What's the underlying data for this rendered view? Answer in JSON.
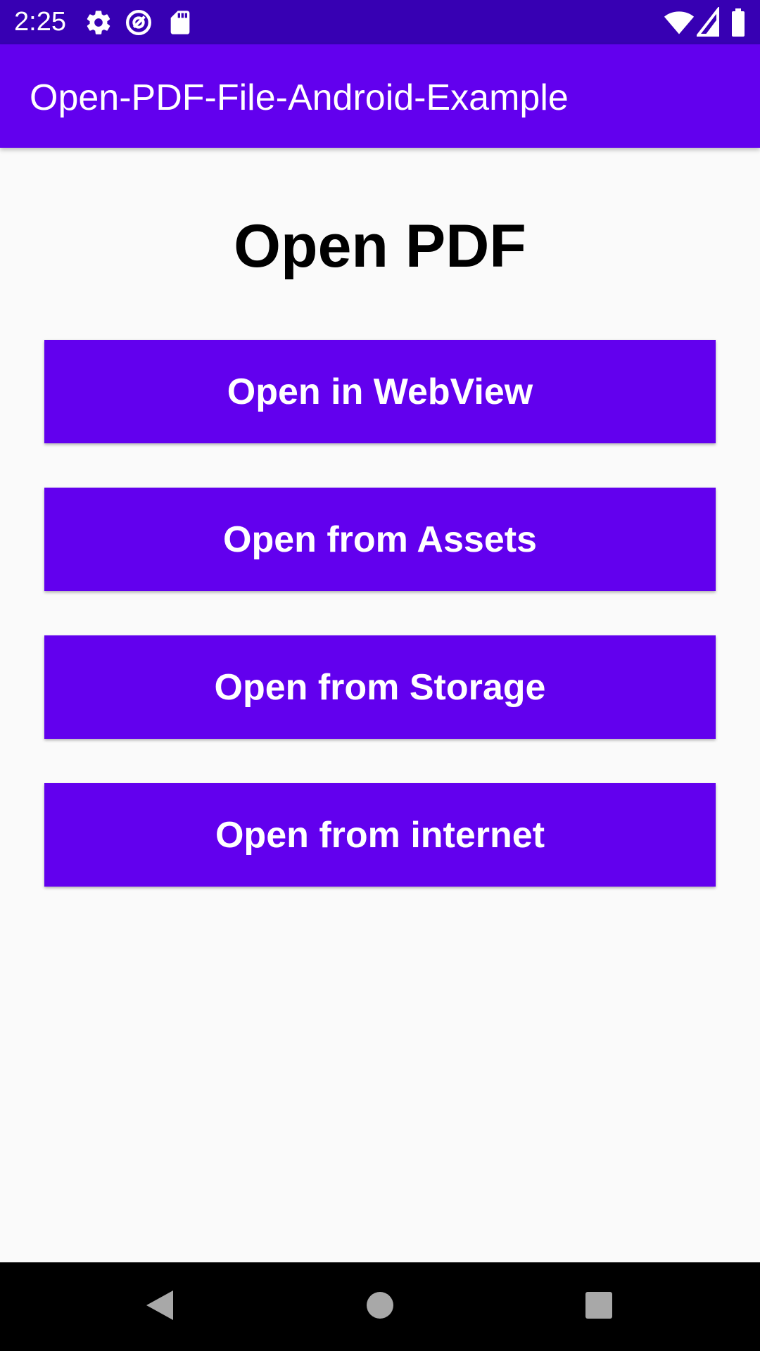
{
  "status_bar": {
    "time": "2:25",
    "icons": [
      "gear-icon",
      "at-sign-icon",
      "sd-card-icon",
      "wifi-icon",
      "signal-icon",
      "battery-icon"
    ],
    "color": "#3700b3"
  },
  "app_bar": {
    "title": "Open-PDF-File-Android-Example",
    "color": "#6200ee"
  },
  "main": {
    "heading": "Open PDF",
    "buttons": [
      {
        "label": "Open in WebView"
      },
      {
        "label": "Open from Assets"
      },
      {
        "label": "Open from Storage"
      },
      {
        "label": "Open from internet"
      }
    ],
    "button_color": "#6200ee"
  },
  "nav_bar": {
    "icons": [
      "back-icon",
      "home-icon",
      "recents-icon"
    ]
  }
}
